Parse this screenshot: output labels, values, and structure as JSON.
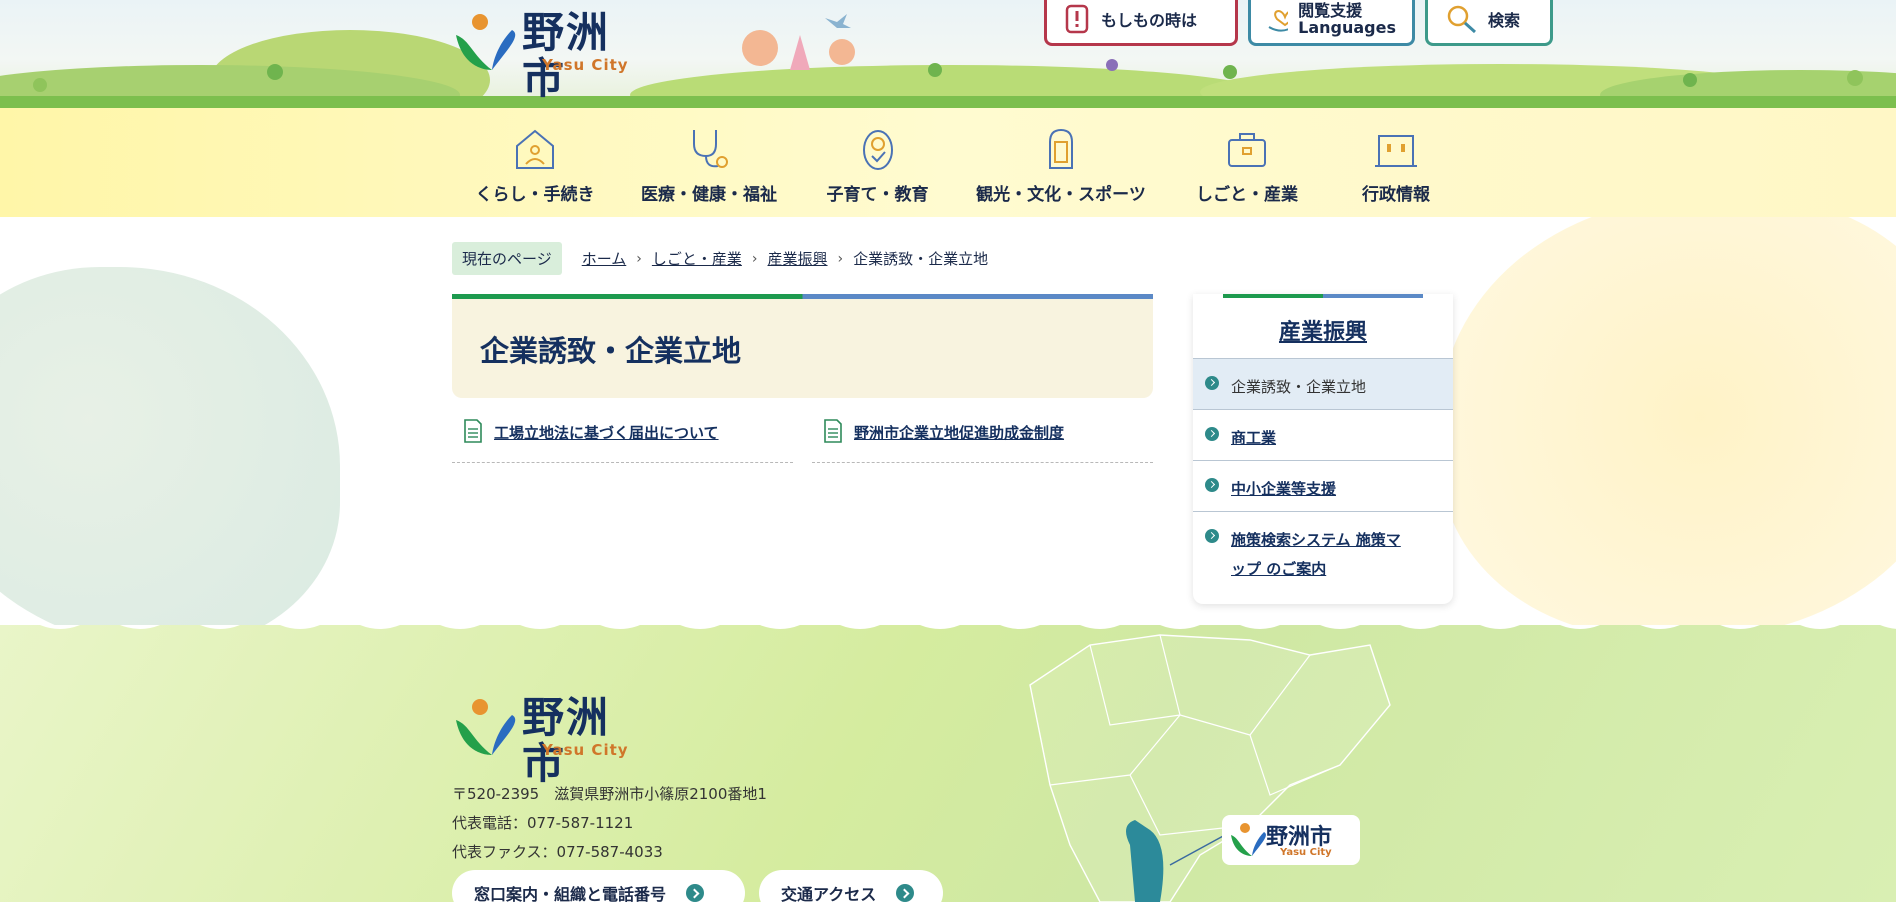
{
  "header": {
    "logo_text": "野洲市",
    "logo_sub": "Yasu City",
    "emergency_label": "もしもの時は",
    "lang_label_1": "閲覧支援",
    "lang_label_2": "Languages",
    "search_label": "検索"
  },
  "nav": {
    "items": [
      {
        "label": "くらし・手続き",
        "icon": "house-person-icon"
      },
      {
        "label": "医療・健康・福祉",
        "icon": "stethoscope-icon"
      },
      {
        "label": "子育て・教育",
        "icon": "baby-icon"
      },
      {
        "label": "観光・文化・スポーツ",
        "icon": "lantern-icon"
      },
      {
        "label": "しごと・産業",
        "icon": "briefcase-icon"
      },
      {
        "label": "行政情報",
        "icon": "building-icon"
      }
    ]
  },
  "breadcrumb": {
    "current_label": "現在のページ",
    "items": [
      "ホーム",
      "しごと・産業",
      "産業振興"
    ],
    "current_page": "企業誘致・企業立地"
  },
  "page": {
    "title": "企業誘致・企業立地",
    "links": [
      "工場立地法に基づく届出について",
      "野洲市企業立地促進助成金制度"
    ]
  },
  "sidebar": {
    "title": "産業振興",
    "items": [
      "企業誘致・企業立地",
      "商工業",
      "中小企業等支援",
      "施策検索システム 施策マ",
      "ップ のご案内"
    ]
  },
  "footer": {
    "logo_text": "野洲市",
    "logo_sub": "Yasu City",
    "address": "〒520-2395　滋賀県野洲市小篠原2100番地1",
    "phone": "代表電話：077-587-1121",
    "fax": "代表ファクス：077-587-4033",
    "btn_contact": "窓口案内・組織と電話番号",
    "btn_access": "交通アクセス",
    "map_logo_text": "野洲市",
    "map_logo_sub": "Yasu City"
  }
}
